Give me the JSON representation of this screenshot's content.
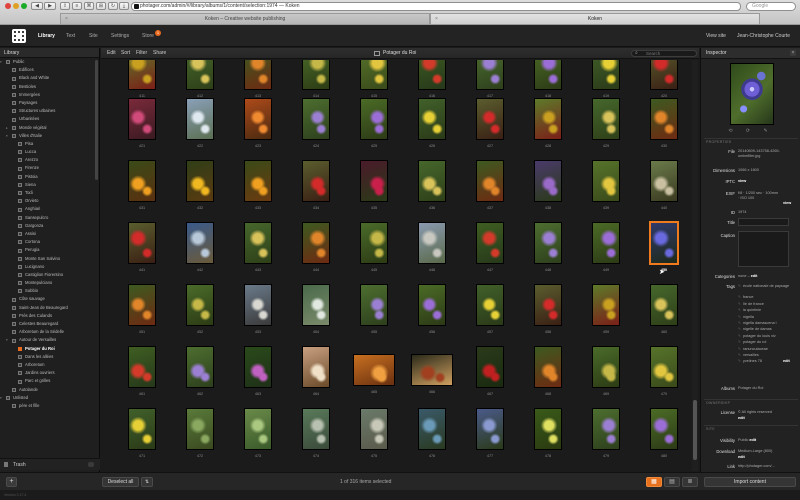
{
  "browser": {
    "url": "photager.com/admin/#/library/albums/1/content/selection:1974 — Koken",
    "search_placeholder": "Google",
    "tabs": [
      {
        "label": "Koken – Creative website publishing"
      },
      {
        "label": "Koken"
      }
    ]
  },
  "app": {
    "nav": [
      "Library",
      "Text",
      "Site",
      "Settings",
      "Store"
    ],
    "store_badge": "1",
    "view_site": "View site",
    "user": "Jean-Christophe Courte"
  },
  "sidebar": {
    "title": "Library",
    "items": [
      {
        "label": "Public",
        "depth": 0,
        "chev": "▾"
      },
      {
        "label": "Edifices",
        "depth": 1
      },
      {
        "label": "Black and White",
        "depth": 1
      },
      {
        "label": "Bestioles",
        "depth": 1
      },
      {
        "label": "Immergées",
        "depth": 1
      },
      {
        "label": "Paysages",
        "depth": 1
      },
      {
        "label": "Structures urbaines",
        "depth": 1
      },
      {
        "label": "Urbanitées",
        "depth": 1
      },
      {
        "label": "Monde végétal",
        "depth": 1,
        "chev": "▸"
      },
      {
        "label": "Villes d'Italie",
        "depth": 1,
        "chev": "▾"
      },
      {
        "label": "Pisa",
        "depth": 2
      },
      {
        "label": "Lucca",
        "depth": 2
      },
      {
        "label": "Arezzo",
        "depth": 2
      },
      {
        "label": "Firenze",
        "depth": 2
      },
      {
        "label": "Pistoia",
        "depth": 2
      },
      {
        "label": "Siena",
        "depth": 2
      },
      {
        "label": "Todi",
        "depth": 2
      },
      {
        "label": "Orvieto",
        "depth": 2
      },
      {
        "label": "Anghiari",
        "depth": 2
      },
      {
        "label": "Sansepulcro",
        "depth": 2
      },
      {
        "label": "Gargonza",
        "depth": 2
      },
      {
        "label": "Assisi",
        "depth": 2
      },
      {
        "label": "Cortona",
        "depth": 2
      },
      {
        "label": "Perugia",
        "depth": 2
      },
      {
        "label": "Monte San Salvino",
        "depth": 2
      },
      {
        "label": "Lucignano",
        "depth": 2
      },
      {
        "label": "Castiglion Fiorentino",
        "depth": 2
      },
      {
        "label": "Montepulciano",
        "depth": 2
      },
      {
        "label": "Subbio",
        "depth": 2
      },
      {
        "label": "Côte sauvage",
        "depth": 1
      },
      {
        "label": "Saint-Jean de Beauregard",
        "depth": 1
      },
      {
        "label": "Prés des Culands",
        "depth": 1
      },
      {
        "label": "Celestes Beauregard",
        "depth": 1
      },
      {
        "label": "Arboretum de la Sédelle",
        "depth": 1
      },
      {
        "label": "Autour de Versailles",
        "depth": 1,
        "chev": "▾"
      },
      {
        "label": "Potager du Roi",
        "depth": 2,
        "active": true
      },
      {
        "label": "Dans les allées",
        "depth": 2
      },
      {
        "label": "Arboretum",
        "depth": 2
      },
      {
        "label": "Jardins ouvriers",
        "depth": 2
      },
      {
        "label": "Parc et grilles",
        "depth": 2
      },
      {
        "label": "Autolande",
        "depth": 1
      },
      {
        "label": "Unlisted",
        "depth": 0,
        "chev": "▾"
      },
      {
        "label": "père et fille",
        "depth": 1
      }
    ],
    "trash": "Trash"
  },
  "toolbar": {
    "items": [
      "Edit",
      "Sort",
      "Filter",
      "Share"
    ],
    "album": "Potager du Roi",
    "search_placeholder": "Search"
  },
  "grid": {
    "rows": [
      {
        "labels": [
          "411",
          "412",
          "413",
          "414",
          "415",
          "416",
          "417",
          "418",
          "419",
          "420"
        ]
      },
      {
        "labels": [
          "421",
          "422",
          "423",
          "424",
          "425",
          "426",
          "427",
          "428",
          "429",
          "430"
        ]
      },
      {
        "labels": [
          "431",
          "432",
          "433",
          "434",
          "435",
          "436",
          "437",
          "438",
          "439",
          "440"
        ]
      },
      {
        "labels": [
          "441",
          "442",
          "443",
          "444",
          "445",
          "446",
          "447",
          "448",
          "449",
          "450"
        ]
      },
      {
        "labels": [
          "451",
          "452",
          "453",
          "454",
          "455",
          "456",
          "457",
          "458",
          "459",
          "460"
        ]
      },
      {
        "labels": [
          "461",
          "462",
          "463",
          "464",
          "465",
          "466",
          "467",
          "468",
          "469",
          "470"
        ]
      },
      {
        "labels": [
          "471",
          "472",
          "473",
          "474",
          "475",
          "476",
          "477",
          "478",
          "479",
          "480"
        ]
      }
    ],
    "selected_label": "450"
  },
  "inspector": {
    "title": "Inspector",
    "sections": {
      "properties": "PROPERTIES",
      "ownership": "OWNERSHIP",
      "site": "SITE"
    },
    "file_key": "File",
    "file_val": "20140609-143758-4269-umbellifer.jpg",
    "dimensions_key": "Dimensions",
    "dimensions_val": "1066 x 1600",
    "iptc_key": "IPTC",
    "iptc_val": "view",
    "exif_key": "EXIF",
    "exif_val": "f/8 · 1/200 sec · 100mm · ISO 100",
    "exif_link": "view",
    "id_key": "ID",
    "id_val": "1974",
    "title_key": "Title",
    "caption_key": "Caption",
    "categories_key": "Categories",
    "categories_val": "none –",
    "edit": "edit",
    "tags_key": "Tags",
    "tags": [
      "école nationale de paysage",
      "france",
      "île de france",
      "la quintinie",
      "nigella",
      "nigella damascena l",
      "nigelle de damas",
      "potager du louis xiv",
      "potager du roi",
      "ranunculaceae",
      "versailles",
      "yvelines 78"
    ],
    "albums_key": "Albums",
    "albums_val": "Potager du Roi",
    "license_key": "License",
    "license_val": "© All rights reserved",
    "visibility_key": "Visibility",
    "visibility_val": "Public",
    "download_key": "Download",
    "download_val": "Medium-Large (800)",
    "link_key": "Link",
    "link_val": "http://photager.com/..."
  },
  "bottom": {
    "add": "+",
    "deselect": "Deselect all",
    "sort": "⇅",
    "selected": "1 of 316 items selected",
    "import": "Import content",
    "version": "Version 0.17.4"
  }
}
